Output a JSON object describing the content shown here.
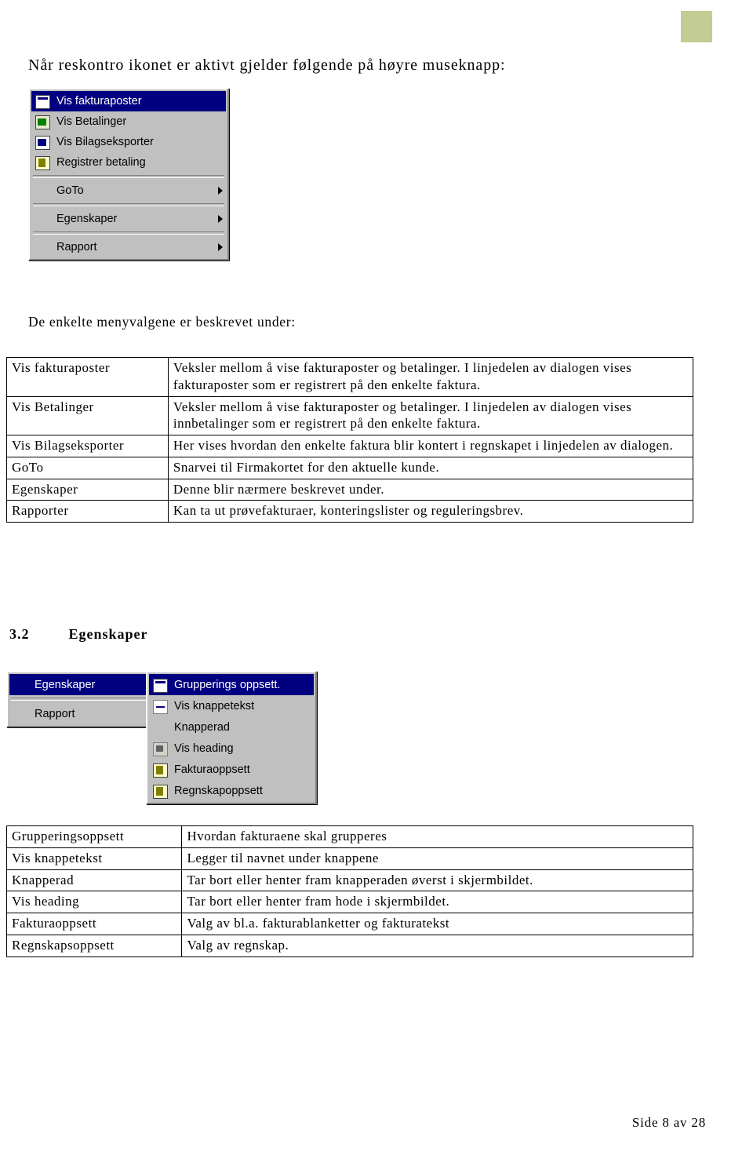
{
  "document": {
    "intro_line": "Når reskontro ikonet er aktivt gjelder følgende på høyre museknapp:",
    "subtitle": "De enkelte menyvalgene er beskrevet under:",
    "footer": "Side 8 av 28"
  },
  "context_menu": {
    "items": [
      {
        "label": "Vis fakturaposter",
        "icon": "invoice-sheet-icon",
        "highlight": true,
        "submenu": false
      },
      {
        "label": "Vis Betalinger",
        "icon": "payment-green-icon",
        "highlight": false,
        "submenu": false
      },
      {
        "label": "Vis Bilagseksporter",
        "icon": "voucher-blue-icon",
        "highlight": false,
        "submenu": false
      },
      {
        "label": "Registrer betaling",
        "icon": "register-money-icon",
        "highlight": false,
        "submenu": false
      },
      {
        "label": "GoTo",
        "icon": "none",
        "highlight": false,
        "submenu": true
      },
      {
        "label": "Egenskaper",
        "icon": "none",
        "highlight": false,
        "submenu": true
      },
      {
        "label": "Rapport",
        "icon": "none",
        "highlight": false,
        "submenu": true
      }
    ]
  },
  "table1": {
    "rows": [
      {
        "term": "Vis fakturaposter",
        "desc": "Veksler mellom å vise fakturaposter og betalinger. I linjedelen av dialogen vises fakturaposter som er registrert på den enkelte faktura."
      },
      {
        "term": "Vis Betalinger",
        "desc": "Veksler mellom å vise fakturaposter og betalinger. I linjedelen av dialogen vises innbetalinger som er registrert på den enkelte faktura."
      },
      {
        "term": "Vis Bilagseksporter",
        "desc": "Her vises hvordan den enkelte faktura blir kontert i regnskapet i linjedelen av dialogen."
      },
      {
        "term": "GoTo",
        "desc": "Snarvei til Firmakortet for den aktuelle kunde."
      },
      {
        "term": "Egenskaper",
        "desc": "Denne blir nærmere beskrevet under."
      },
      {
        "term": "Rapporter",
        "desc": "Kan ta ut prøvefakturaer, konteringslister og reguleringsbrev."
      }
    ]
  },
  "section": {
    "number": "3.2",
    "title": "Egenskaper"
  },
  "menu_left": {
    "items": [
      {
        "label": "Egenskaper",
        "highlight": true,
        "submenu": true
      },
      {
        "label": "Rapport",
        "highlight": false,
        "submenu": true
      }
    ]
  },
  "menu_right": {
    "items": [
      {
        "label": "Grupperings oppsett.",
        "icon": "settings-sheet-icon",
        "highlight": true
      },
      {
        "label": "Vis knappetekst",
        "icon": "dash-icon",
        "highlight": false
      },
      {
        "label": "Knapperad",
        "icon": "none",
        "highlight": false
      },
      {
        "label": "Vis heading",
        "icon": "heading-icon",
        "highlight": false
      },
      {
        "label": "Fakturaoppsett",
        "icon": "gear-icon",
        "highlight": false
      },
      {
        "label": "Regnskapoppsett",
        "icon": "gear-icon",
        "highlight": false
      }
    ]
  },
  "table2": {
    "rows": [
      {
        "term": "Grupperingsoppsett",
        "desc": "Hvordan fakturaene skal grupperes"
      },
      {
        "term": "Vis knappetekst",
        "desc": "Legger til navnet under knappene"
      },
      {
        "term": "Knapperad",
        "desc": "Tar bort eller henter fram knapperaden øverst i skjermbildet."
      },
      {
        "term": "Vis heading",
        "desc": "Tar bort eller henter fram hode i skjermbildet."
      },
      {
        "term": "Fakturaoppsett",
        "desc": "Valg av bl.a. fakturablanketter og fakturatekst"
      },
      {
        "term": "Regnskapsoppsett",
        "desc": "Valg av regnskap."
      }
    ]
  }
}
